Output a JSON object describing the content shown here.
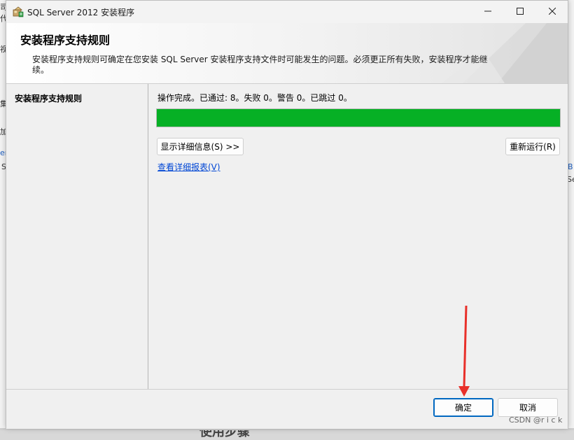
{
  "background": {
    "fragments": [
      "司",
      "代",
      "视",
      "集",
      "加",
      "er",
      "S",
      "B",
      "Se"
    ],
    "bottom_heading": "使用步骤"
  },
  "window": {
    "title": "SQL Server 2012 安装程序",
    "icon": "sql-server-setup-icon",
    "controls": {
      "minimize": "minimize-icon",
      "maximize": "maximize-icon",
      "close": "close-icon"
    }
  },
  "header": {
    "title": "安装程序支持规则",
    "description": "安装程序支持规则可确定在您安装 SQL Server 安装程序支持文件时可能发生的问题。必须更正所有失败，安装程序才能继续。"
  },
  "sidebar": {
    "items": [
      {
        "label": "安装程序支持规则",
        "active": true
      }
    ]
  },
  "main": {
    "status": "操作完成。已通过: 8。失败 0。警告 0。已跳过 0。",
    "progress": 100,
    "progress_color": "#06b025",
    "show_details_label": "显示详细信息(S) >>",
    "rerun_label": "重新运行(R)",
    "view_report_label": "查看详细报表(V)"
  },
  "footer": {
    "ok_label": "确定",
    "cancel_label": "取消"
  },
  "annotation": {
    "type": "arrow",
    "color": "#e8302a",
    "points_to": "ok-button"
  },
  "watermark": "CSDN @r i c k"
}
